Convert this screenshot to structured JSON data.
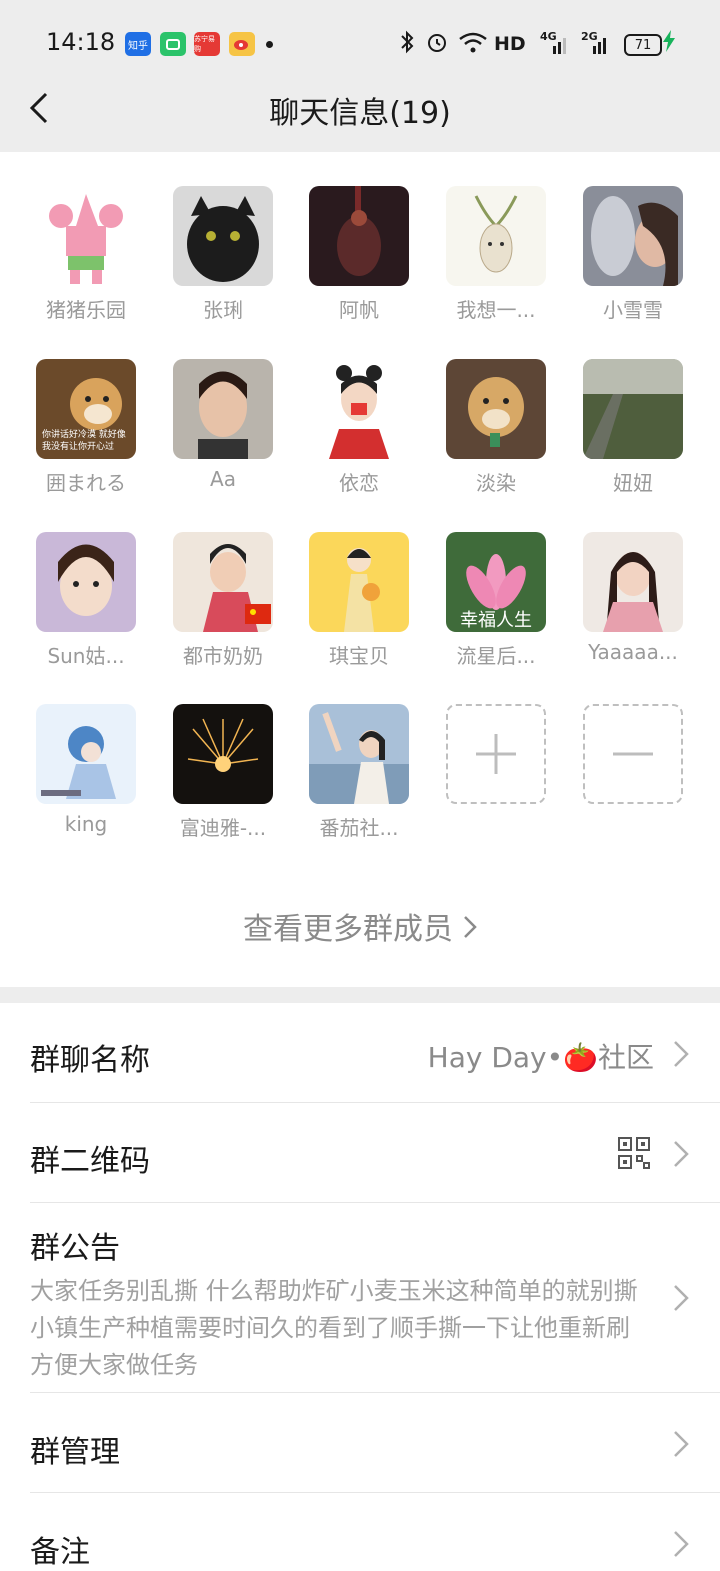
{
  "status_bar": {
    "time": "14:18",
    "app_icons": [
      "zhihu-icon",
      "app-green-icon",
      "suning-icon",
      "weibo-icon"
    ],
    "zhihu_label": "知乎",
    "suning_label": "苏宁易购",
    "hd_label": "HD",
    "net1": "4G",
    "net2": "2G",
    "battery": "71"
  },
  "header": {
    "title": "聊天信息(19)"
  },
  "members": [
    {
      "name": "猪猪乐园"
    },
    {
      "name": "张琍"
    },
    {
      "name": "阿帆"
    },
    {
      "name": "我想一..."
    },
    {
      "name": "小雪雪"
    },
    {
      "name": "囲まれる"
    },
    {
      "name": "Aa"
    },
    {
      "name": "依恋"
    },
    {
      "name": "淡染"
    },
    {
      "name": "妞妞"
    },
    {
      "name": "Sun姑..."
    },
    {
      "name": "都市奶奶"
    },
    {
      "name": "琪宝贝"
    },
    {
      "name": "流星后..."
    },
    {
      "name": "Yaaaaa..."
    },
    {
      "name": "king"
    },
    {
      "name": "富迪雅-..."
    },
    {
      "name": "番茄社..."
    }
  ],
  "avatar_texts": {
    "shiba_caption": "你讲话好冷漠 就好像我没有让你开心过",
    "lotus_caption": "幸福人生"
  },
  "view_more": "查看更多群成员",
  "settings": {
    "group_name_label": "群聊名称",
    "group_name_value": "Hay Day•🍅社区",
    "qr_label": "群二维码",
    "announcement_label": "群公告",
    "announcement_text": "大家任务别乱撕  什么帮助炸矿小麦玉米这种简单的就别撕  小镇生产种植需要时间久的看到了顺手撕一下让他重新刷方便大家做任务",
    "manage_label": "群管理",
    "remark_label": "备注"
  },
  "colors": {
    "header_bg": "#ededed",
    "accent_green": "#18b35b"
  }
}
